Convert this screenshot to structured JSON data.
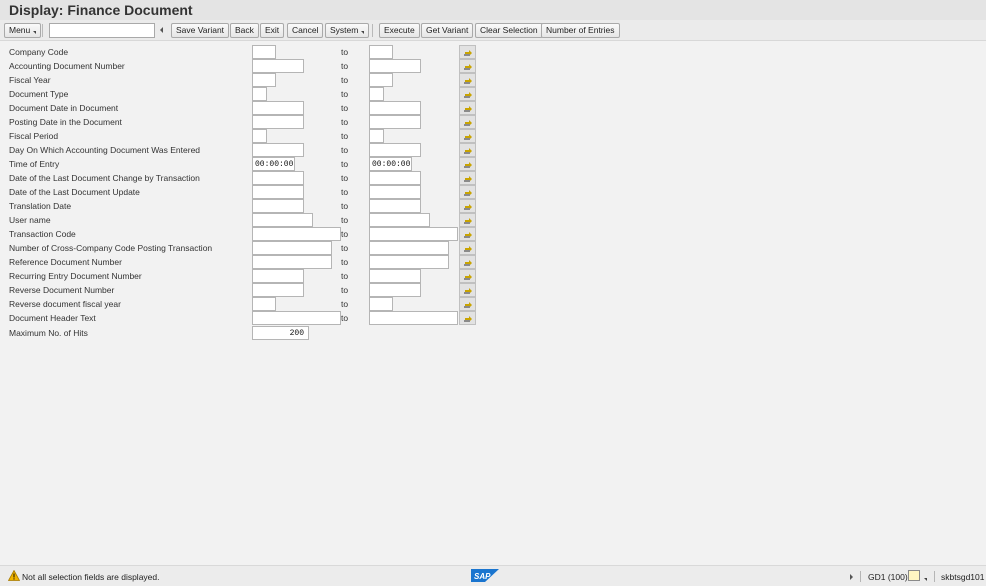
{
  "window": {
    "title": "Display: Finance Document"
  },
  "toolbar": {
    "menu_label": "Menu",
    "save_variant": "Save Variant",
    "back": "Back",
    "exit": "Exit",
    "cancel": "Cancel",
    "system": "System",
    "execute": "Execute",
    "get_variant": "Get Variant",
    "clear_selection": "Clear Selection",
    "number_of_entries": "Number of Entries",
    "command_value": ""
  },
  "selection": {
    "to_label": "to",
    "rows": [
      {
        "label": "Company Code",
        "from": "",
        "to": ""
      },
      {
        "label": "Accounting Document Number",
        "from": "",
        "to": ""
      },
      {
        "label": "Fiscal Year",
        "from": "",
        "to": ""
      },
      {
        "label": "Document Type",
        "from": "",
        "to": ""
      },
      {
        "label": "Document Date in Document",
        "from": "",
        "to": ""
      },
      {
        "label": "Posting Date in the Document",
        "from": "",
        "to": ""
      },
      {
        "label": "Fiscal Period",
        "from": "",
        "to": ""
      },
      {
        "label": "Day On Which Accounting Document Was Entered",
        "from": "",
        "to": ""
      },
      {
        "label": "Time of Entry",
        "from": "00:00:00",
        "to": "00:00:00"
      },
      {
        "label": "Date of the Last Document Change by Transaction",
        "from": "",
        "to": ""
      },
      {
        "label": "Date of the Last Document Update",
        "from": "",
        "to": ""
      },
      {
        "label": "Translation Date",
        "from": "",
        "to": ""
      },
      {
        "label": "User name",
        "from": "",
        "to": ""
      },
      {
        "label": "Transaction Code",
        "from": "",
        "to": ""
      },
      {
        "label": "Number of Cross-Company Code Posting Transaction",
        "from": "",
        "to": ""
      },
      {
        "label": "Reference Document Number",
        "from": "",
        "to": ""
      },
      {
        "label": "Recurring Entry Document Number",
        "from": "",
        "to": ""
      },
      {
        "label": "Reverse Document Number",
        "from": "",
        "to": ""
      },
      {
        "label": "Reverse document fiscal year",
        "from": "",
        "to": ""
      },
      {
        "label": "Document Header Text",
        "from": "",
        "to": ""
      }
    ],
    "max_hits": {
      "label": "Maximum No. of Hits",
      "value": "200"
    }
  },
  "status": {
    "message": "Not all selection fields are displayed.",
    "system": "GD1 (100)",
    "server": "skbtsgd101",
    "message_icon": "warning-icon"
  },
  "colors": {
    "background": "#f2f2f2",
    "title_bar": "#e4e4e4",
    "sap_blue": "#1a75cf"
  }
}
